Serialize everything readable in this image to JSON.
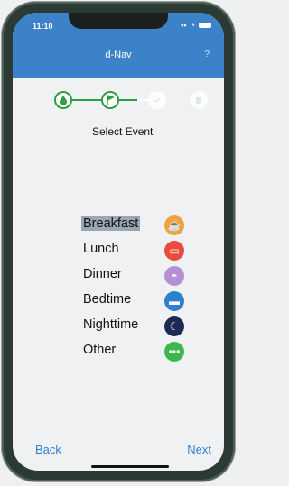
{
  "status_bar": {
    "time": "11:10",
    "icons": [
      "signal-icon",
      "wifi-icon",
      "battery-icon"
    ]
  },
  "nav": {
    "title": "d-Nav",
    "help": "?"
  },
  "stepper": {
    "steps": [
      {
        "icon": "drop-icon",
        "state": "done"
      },
      {
        "icon": "flag-icon",
        "state": "done"
      },
      {
        "icon": "check-icon",
        "state": "future"
      },
      {
        "icon": "clipboard-icon",
        "state": "future"
      }
    ],
    "label": "Select Event"
  },
  "events": [
    {
      "label": "Breakfast",
      "icon": "breakfast-icon",
      "selected": true
    },
    {
      "label": "Lunch",
      "icon": "lunch-icon",
      "selected": false
    },
    {
      "label": "Dinner",
      "icon": "dinner-icon",
      "selected": false
    },
    {
      "label": "Bedtime",
      "icon": "bedtime-icon",
      "selected": false
    },
    {
      "label": "Nighttime",
      "icon": "nighttime-icon",
      "selected": false
    },
    {
      "label": "Other",
      "icon": "other-icon",
      "selected": false
    }
  ],
  "buttons": {
    "back": "Back",
    "next": "Next"
  },
  "colors": {
    "header": "#3b82c8",
    "accent": "#2e9e43",
    "link": "#2f7fd0",
    "selection": "#9aa6b4"
  }
}
